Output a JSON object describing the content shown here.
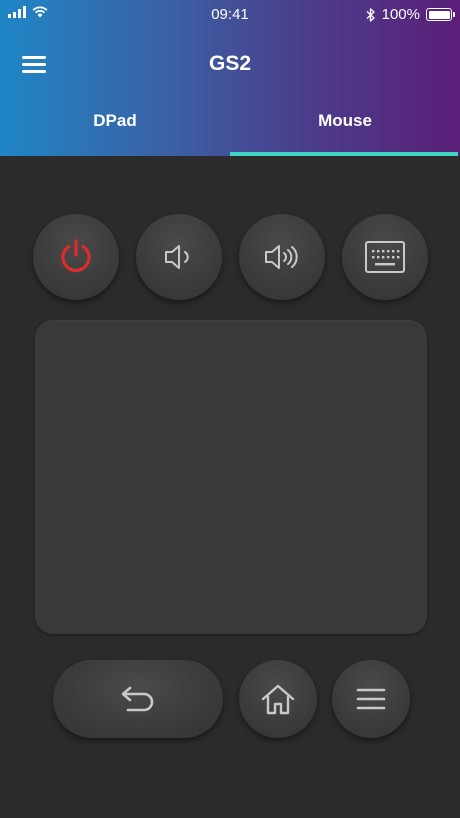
{
  "status_bar": {
    "time": "09:41",
    "battery": "100%"
  },
  "header": {
    "title": "GS2"
  },
  "tabs": [
    {
      "label": "DPad",
      "active": false
    },
    {
      "label": "Mouse",
      "active": true
    }
  ],
  "colors": {
    "accent": "#3ed3c2",
    "power": "#e02b2b",
    "background": "#2b2b2b"
  },
  "controls": {
    "top_row": [
      "power-icon",
      "volume-down-icon",
      "volume-up-icon",
      "keyboard-icon"
    ],
    "bottom_row": [
      "back-icon",
      "home-icon",
      "menu-icon"
    ]
  }
}
